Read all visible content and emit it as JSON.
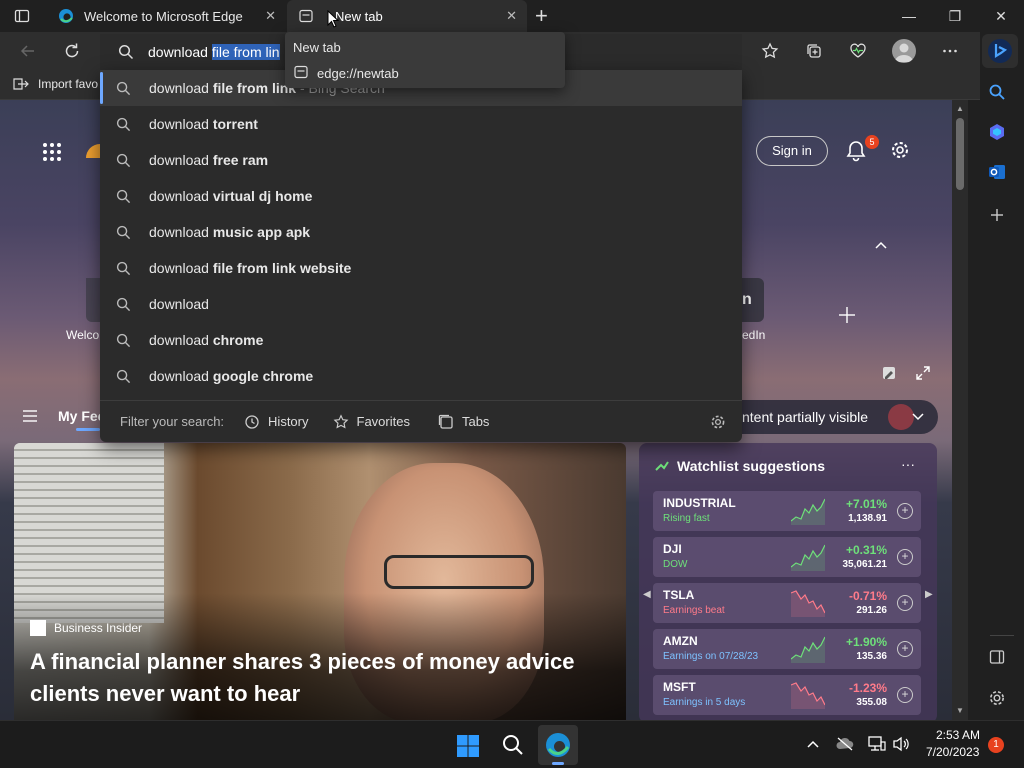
{
  "tabs": [
    {
      "title": "Welcome to Microsoft Edge",
      "close": "✕"
    },
    {
      "title": "New tab",
      "close": "✕"
    }
  ],
  "new_tab_glyph": "+",
  "window_controls": {
    "minimize": "—",
    "restore": "❐",
    "close": "✕"
  },
  "address": {
    "typed": "download ",
    "highlighted": "file from lin"
  },
  "favorites_bar": {
    "import_label": "Import favo"
  },
  "tooltip": {
    "title": "New tab",
    "url": "edge://newtab"
  },
  "suggestions": [
    {
      "prefix": "download ",
      "bold": "file from link",
      "suffix": " - Bing Search"
    },
    {
      "prefix": "download ",
      "bold": "torrent",
      "suffix": ""
    },
    {
      "prefix": "download ",
      "bold": "free ram",
      "suffix": ""
    },
    {
      "prefix": "download ",
      "bold": "virtual dj home",
      "suffix": ""
    },
    {
      "prefix": "download ",
      "bold": "music app apk",
      "suffix": ""
    },
    {
      "prefix": "download ",
      "bold": "file from link website",
      "suffix": ""
    },
    {
      "prefix": "download",
      "bold": "",
      "suffix": ""
    },
    {
      "prefix": "download ",
      "bold": "chrome",
      "suffix": ""
    },
    {
      "prefix": "download ",
      "bold": "google chrome",
      "suffix": ""
    }
  ],
  "filter": {
    "label": "Filter your search:",
    "history": "History",
    "favorites": "Favorites",
    "tabs": "Tabs"
  },
  "newtab": {
    "signin": "Sign in",
    "notif_count": "5",
    "quicklink_welcome": "Welco",
    "quicklink_linkedin": "edIn",
    "feed_label": "My Fee",
    "content_visibility": "ntent partially visible"
  },
  "article": {
    "source": "Business Insider",
    "headline_line1": "A financial planner shares 3 pieces of money advice",
    "headline_line2": "clients never want to hear"
  },
  "watchlist": {
    "title": "Watchlist suggestions",
    "more": "···",
    "items": [
      {
        "symbol": "INDUSTRIAL",
        "sub": "Rising fast",
        "change": "+7.01%",
        "price": "1,138.91",
        "trend": "up"
      },
      {
        "symbol": "DJI",
        "sub": "DOW",
        "change": "+0.31%",
        "price": "35,061.21",
        "trend": "up"
      },
      {
        "symbol": "TSLA",
        "sub": "Earnings beat",
        "change": "-0.71%",
        "price": "291.26",
        "trend": "down"
      },
      {
        "symbol": "AMZN",
        "sub": "Earnings on 07/28/23",
        "change": "+1.90%",
        "price": "135.36",
        "trend": "up"
      },
      {
        "symbol": "MSFT",
        "sub": "Earnings in 5 days",
        "change": "-1.23%",
        "price": "355.08",
        "trend": "down"
      }
    ]
  },
  "taskbar": {
    "time": "2:53 AM",
    "date": "7/20/2023",
    "notifications": "1"
  },
  "colors": {
    "up": "#6ee07a",
    "down": "#ff7b8a",
    "accent": "#6ea8ff"
  }
}
